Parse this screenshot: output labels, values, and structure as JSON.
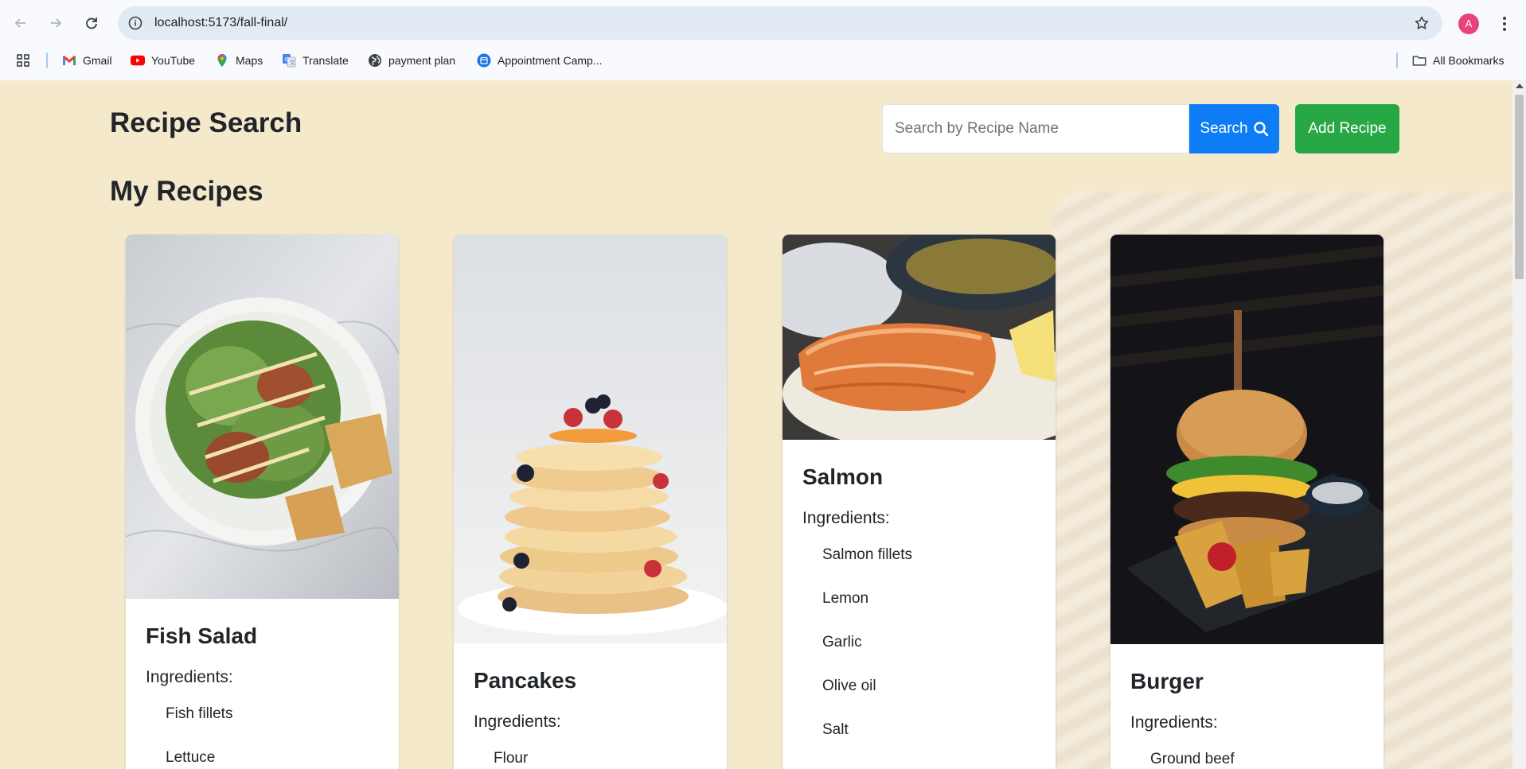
{
  "browser": {
    "url": "localhost:5173/fall-final/",
    "profile_initial": "A",
    "bookmarks": [
      {
        "label": "Gmail",
        "icon": "gmail-icon"
      },
      {
        "label": "YouTube",
        "icon": "youtube-icon"
      },
      {
        "label": "Maps",
        "icon": "maps-icon"
      },
      {
        "label": "Translate",
        "icon": "translate-icon"
      },
      {
        "label": "payment plan",
        "icon": "globe-icon"
      },
      {
        "label": "Appointment Camp...",
        "icon": "calendar-icon"
      }
    ],
    "all_bookmarks_label": "All Bookmarks"
  },
  "page": {
    "title": "Recipe Search",
    "subtitle": "My Recipes",
    "search": {
      "placeholder": "Search by Recipe Name",
      "button_label": "Search"
    },
    "add_button_label": "Add Recipe",
    "ingredients_label": "Ingredients:",
    "recipes": [
      {
        "name": "Fish Salad",
        "ingredients": [
          "Fish fillets",
          "Lettuce"
        ]
      },
      {
        "name": "Pancakes",
        "ingredients": [
          "Flour"
        ]
      },
      {
        "name": "Salmon",
        "ingredients": [
          "Salmon fillets",
          "Lemon",
          "Garlic",
          "Olive oil",
          "Salt"
        ]
      },
      {
        "name": "Burger",
        "ingredients": [
          "Ground beef"
        ]
      }
    ]
  },
  "colors": {
    "page_bg": "#f5e9cc",
    "search_button": "#0d7cf5",
    "add_button": "#28a745"
  }
}
